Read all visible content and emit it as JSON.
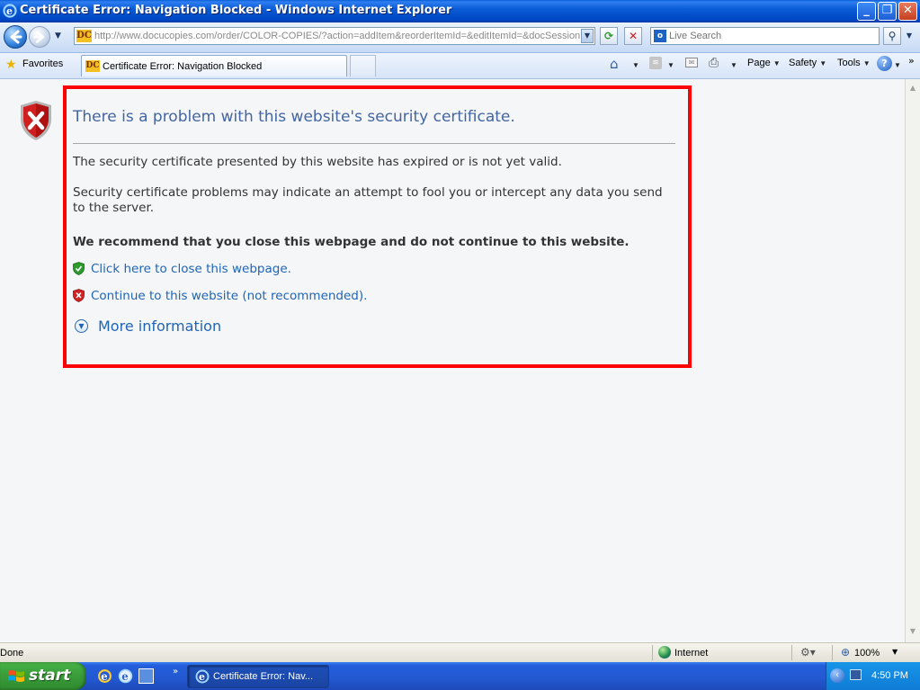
{
  "window": {
    "title": "Certificate Error: Navigation Blocked - Windows Internet Explorer",
    "minimize_label": "_",
    "maximize_label": "❐",
    "close_label": "✕"
  },
  "address_bar": {
    "url": "http://www.docucopies.com/order/COLOR-COPIES/?action=addItem&reorderItemId=&editItemId=&docSession",
    "site_icon_text": "DC"
  },
  "search": {
    "placeholder": "Live Search",
    "provider_icon_text": "o"
  },
  "favorites": {
    "label": "Favorites"
  },
  "tab": {
    "title": "Certificate Error: Navigation Blocked",
    "favicon_text": "DC"
  },
  "command_bar": {
    "page_label": "Page",
    "safety_label": "Safety",
    "tools_label": "Tools",
    "help_label": "?"
  },
  "error_page": {
    "title": "There is a problem with this website's security certificate.",
    "paragraph_1": "The security certificate presented by this website has expired or is not yet valid.",
    "paragraph_2": "Security certificate problems may indicate an attempt to fool you or intercept any data you send to the server.",
    "recommendation": "We recommend that you close this webpage and do not continue to this website.",
    "close_link": "Click here to close this webpage.",
    "continue_link": "Continue to this website (not recommended).",
    "more_info": "More information",
    "frame_color": "#ff0000",
    "link_color": "#1f64b6",
    "title_color": "#4465a2"
  },
  "status_bar": {
    "status": "Done",
    "zone": "Internet",
    "zoom": "100%"
  },
  "taskbar": {
    "start_label": "start",
    "task_label": "Certificate Error: Nav...",
    "clock": "4:50 PM"
  },
  "icons": [
    "ie-icon",
    "back-arrow-icon",
    "forward-arrow-icon",
    "refresh-icon",
    "stop-icon",
    "search-icon",
    "star-icon",
    "home-icon",
    "feeds-icon",
    "mail-icon",
    "print-icon",
    "help-icon",
    "error-shield-icon",
    "green-shield-icon",
    "red-shield-icon",
    "expand-icon",
    "globe-icon",
    "zoom-icon",
    "windows-flag-icon"
  ]
}
